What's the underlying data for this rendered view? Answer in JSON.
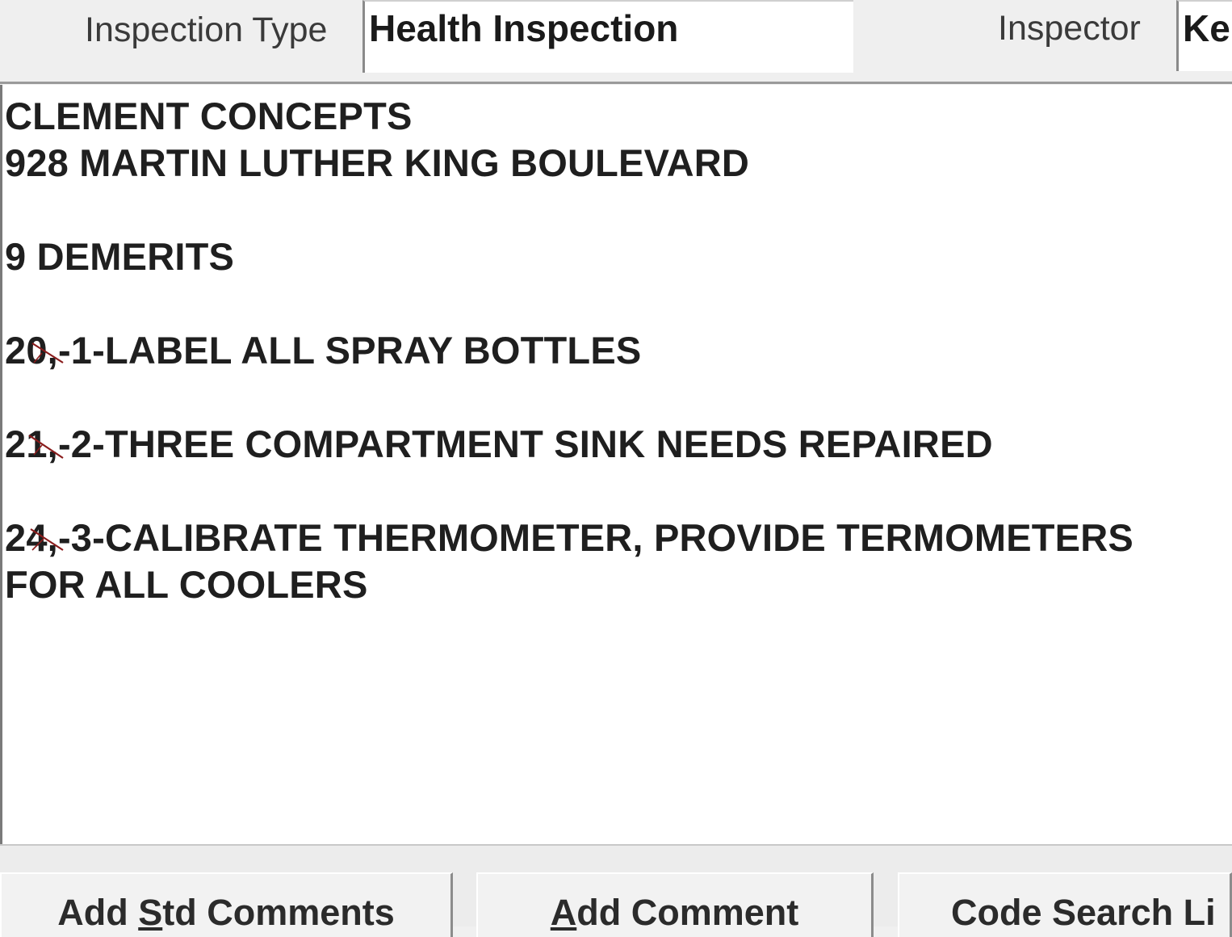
{
  "header": {
    "inspection_type_label": "Inspection Type",
    "inspection_type_value": "Health Inspection",
    "inspector_label": "Inspector",
    "inspector_value": "Ke"
  },
  "memo": {
    "business_name": "CLEMENT CONCEPTS",
    "address": "928 MARTIN LUTHER KING BOULEVARD",
    "demerits": "9 DEMERITS",
    "violations": [
      {
        "code": "20,",
        "text": "-1-LABEL ALL SPRAY BOTTLES"
      },
      {
        "code": "21,",
        "text": "-2-THREE COMPARTMENT SINK NEEDS REPAIRED"
      },
      {
        "code": "24,",
        "text": "-3-CALIBRATE THERMOMETER, PROVIDE TERMOMETERS",
        "continuation": "FOR ALL COOLERS"
      }
    ]
  },
  "buttons": {
    "std_comments": {
      "before": "Add ",
      "underline": "S",
      "after": "td Comments"
    },
    "add_comment": {
      "before": "",
      "underline": "A",
      "after": "dd Comment"
    },
    "code_search": "Code Search Li"
  }
}
